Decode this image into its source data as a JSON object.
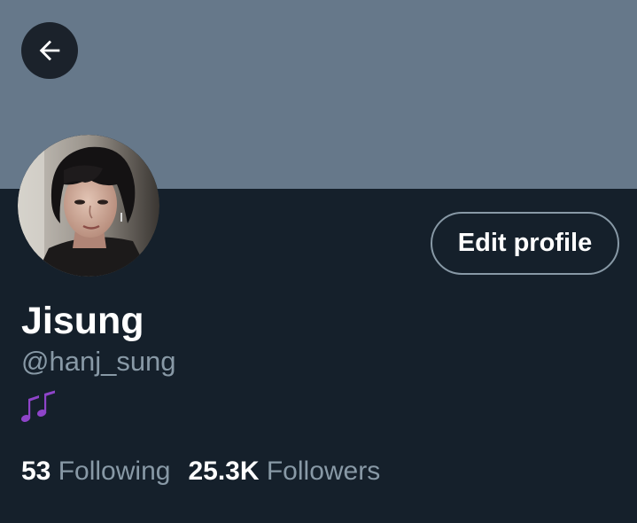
{
  "header": {
    "back_icon": "arrow-left-icon"
  },
  "profile": {
    "display_name": "Jisung",
    "handle": "@hanj_sung",
    "bio": "🎶",
    "bio_icon": "musical-notes-icon",
    "edit_button_label": "Edit profile"
  },
  "stats": {
    "following_count": "53",
    "following_label": "Following",
    "followers_count": "25.3K",
    "followers_label": "Followers"
  },
  "colors": {
    "background": "#15202b",
    "banner": "#66788a",
    "secondary_text": "#8899a6",
    "primary_text": "#ffffff",
    "emoji": "#8e44c9"
  }
}
